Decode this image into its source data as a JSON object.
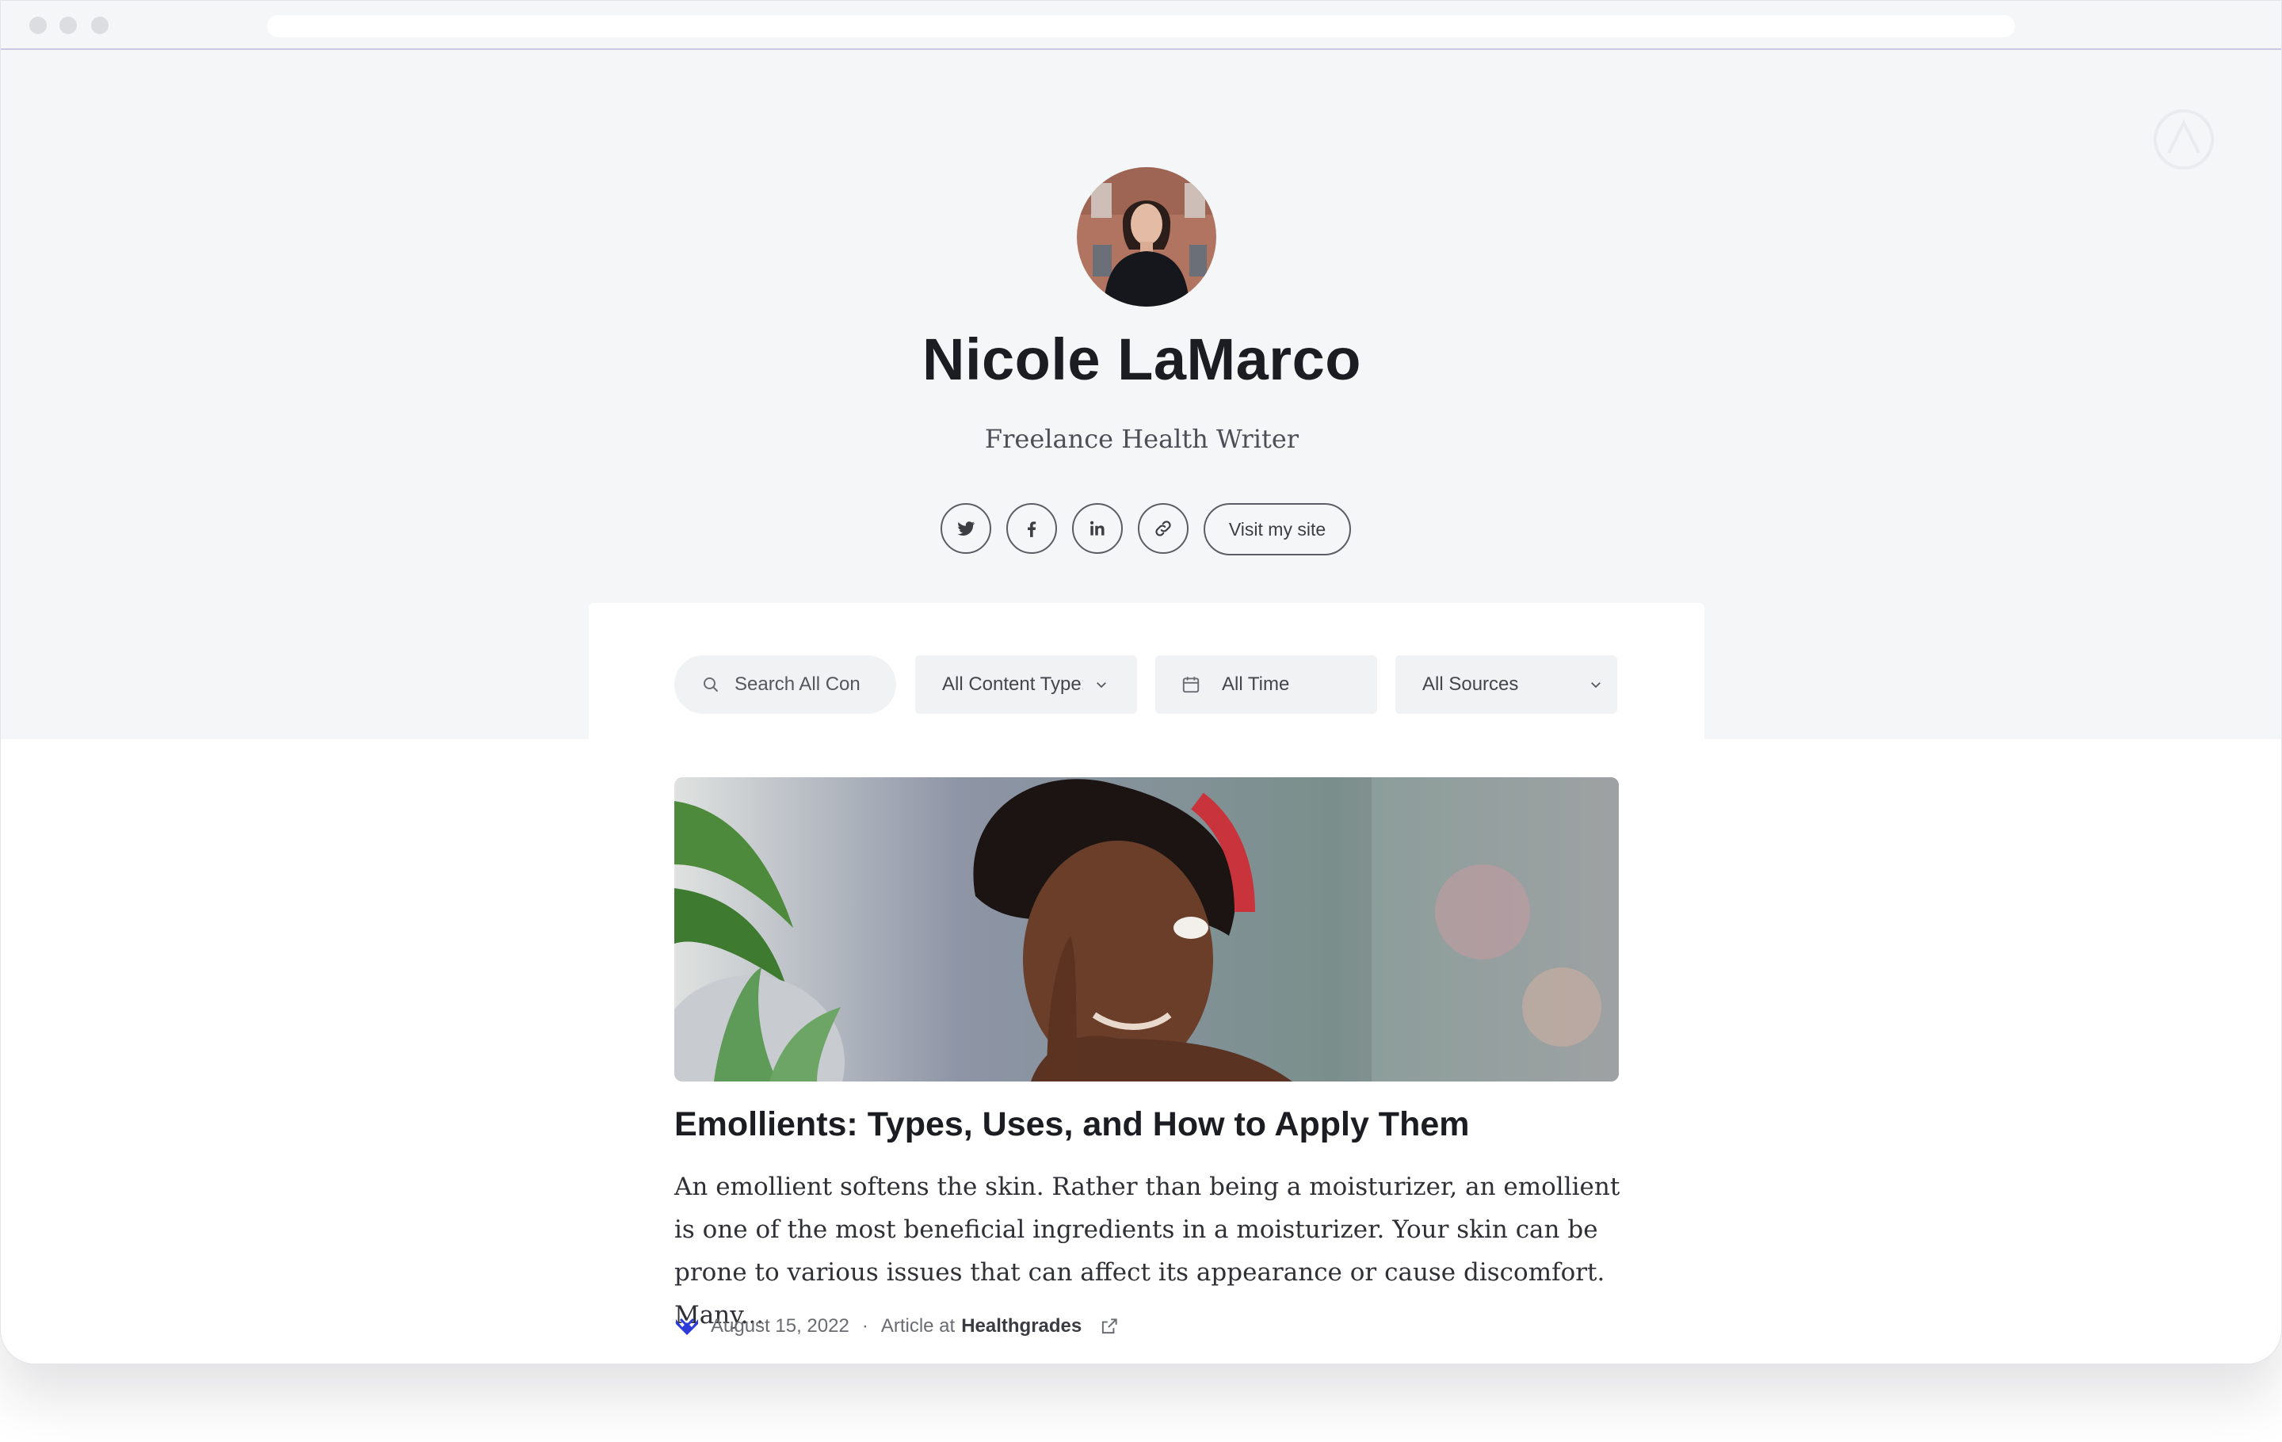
{
  "profile": {
    "name": "Nicole LaMarco",
    "tagline": "Freelance Health Writer",
    "visit_label": "Visit my site"
  },
  "social": [
    {
      "icon": "twitter-icon"
    },
    {
      "icon": "facebook-icon"
    },
    {
      "icon": "linkedin-icon"
    },
    {
      "icon": "link-icon"
    }
  ],
  "filters": {
    "search_placeholder": "Search All Con",
    "content_type": "All Content Type:",
    "time": "All Time",
    "sources": "All Sources"
  },
  "article": {
    "title": "Emollients: Types, Uses, and How to Apply Them",
    "excerpt": "An emollient softens the skin. Rather than being a moisturizer, an emollient is one of the most beneficial ingredients in a moisturizer. Your skin can be prone to various issues that can affect its appearance or cause discomfort. Many...",
    "date": "August 15, 2022",
    "separator": "·",
    "type_label": "Article at",
    "source": "Healthgrades"
  },
  "colors": {
    "hero_background": "#f5f6f8",
    "text_dark": "#1c1d22",
    "source_logo": "#2d3bd8"
  }
}
